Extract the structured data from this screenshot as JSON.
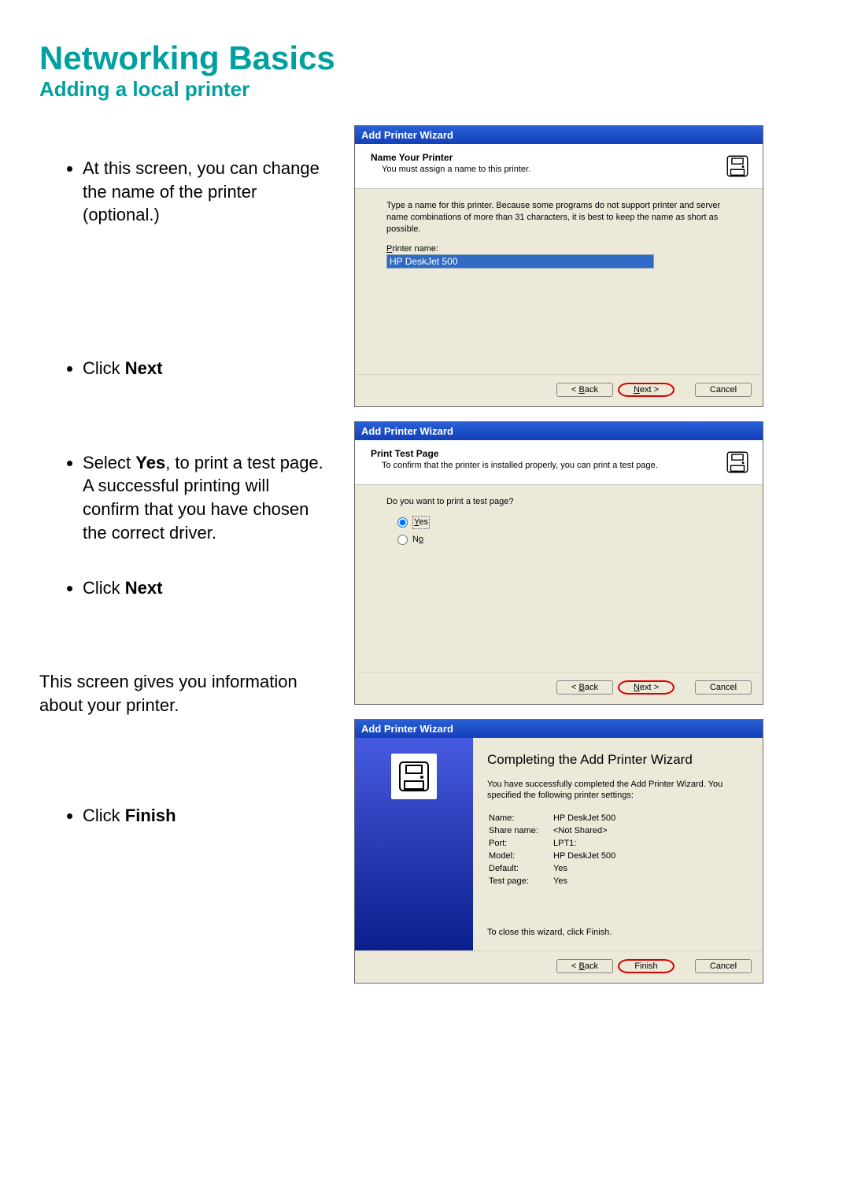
{
  "page": {
    "title": "Networking Basics",
    "subtitle": "Adding a local printer"
  },
  "instructions": {
    "li1": "At this screen, you can change the name of the printer (optional.)",
    "li2_pre": "Click ",
    "li2_bold": "Next",
    "li3_pre": "Select  ",
    "li3_bold": "Yes",
    "li3_post": ", to print a test page.  A successful printing will confirm that you have chosen the correct driver.",
    "li4_pre": "Click ",
    "li4_bold": "Next",
    "para": "This screen gives you information about your printer.",
    "li5_pre": "Click ",
    "li5_bold": "Finish"
  },
  "wizard1": {
    "title": "Add Printer Wizard",
    "header_title": "Name Your Printer",
    "header_sub": "You must assign a name to this printer.",
    "body_text": "Type a name for this printer. Because some programs do not support printer and server name combinations of more than 31 characters, it is best to keep the name as short as possible.",
    "input_label": "Printer name:",
    "input_value": "HP DeskJet 500",
    "buttons": {
      "back": "< Back",
      "next": "Next >",
      "cancel": "Cancel"
    }
  },
  "wizard2": {
    "title": "Add Printer Wizard",
    "header_title": "Print Test Page",
    "header_sub": "To confirm that the printer is installed properly, you can print a test page.",
    "question": "Do you want to print a test page?",
    "opt_yes": "Yes",
    "opt_no": "No",
    "buttons": {
      "back": "< Back",
      "next": "Next >",
      "cancel": "Cancel"
    }
  },
  "wizard3": {
    "title": "Add Printer Wizard",
    "complete_title": "Completing the Add Printer Wizard",
    "complete_desc": "You have successfully completed the Add Printer Wizard. You specified the following printer settings:",
    "kv": {
      "name_label": "Name:",
      "name_value": "HP DeskJet 500",
      "share_label": "Share name:",
      "share_value": "<Not Shared>",
      "port_label": "Port:",
      "port_value": "LPT1:",
      "model_label": "Model:",
      "model_value": "HP DeskJet 500",
      "default_label": "Default:",
      "default_value": "Yes",
      "test_label": "Test page:",
      "test_value": "Yes"
    },
    "close_msg": "To close this wizard, click Finish.",
    "buttons": {
      "back": "< Back",
      "finish": "Finish",
      "cancel": "Cancel"
    }
  }
}
